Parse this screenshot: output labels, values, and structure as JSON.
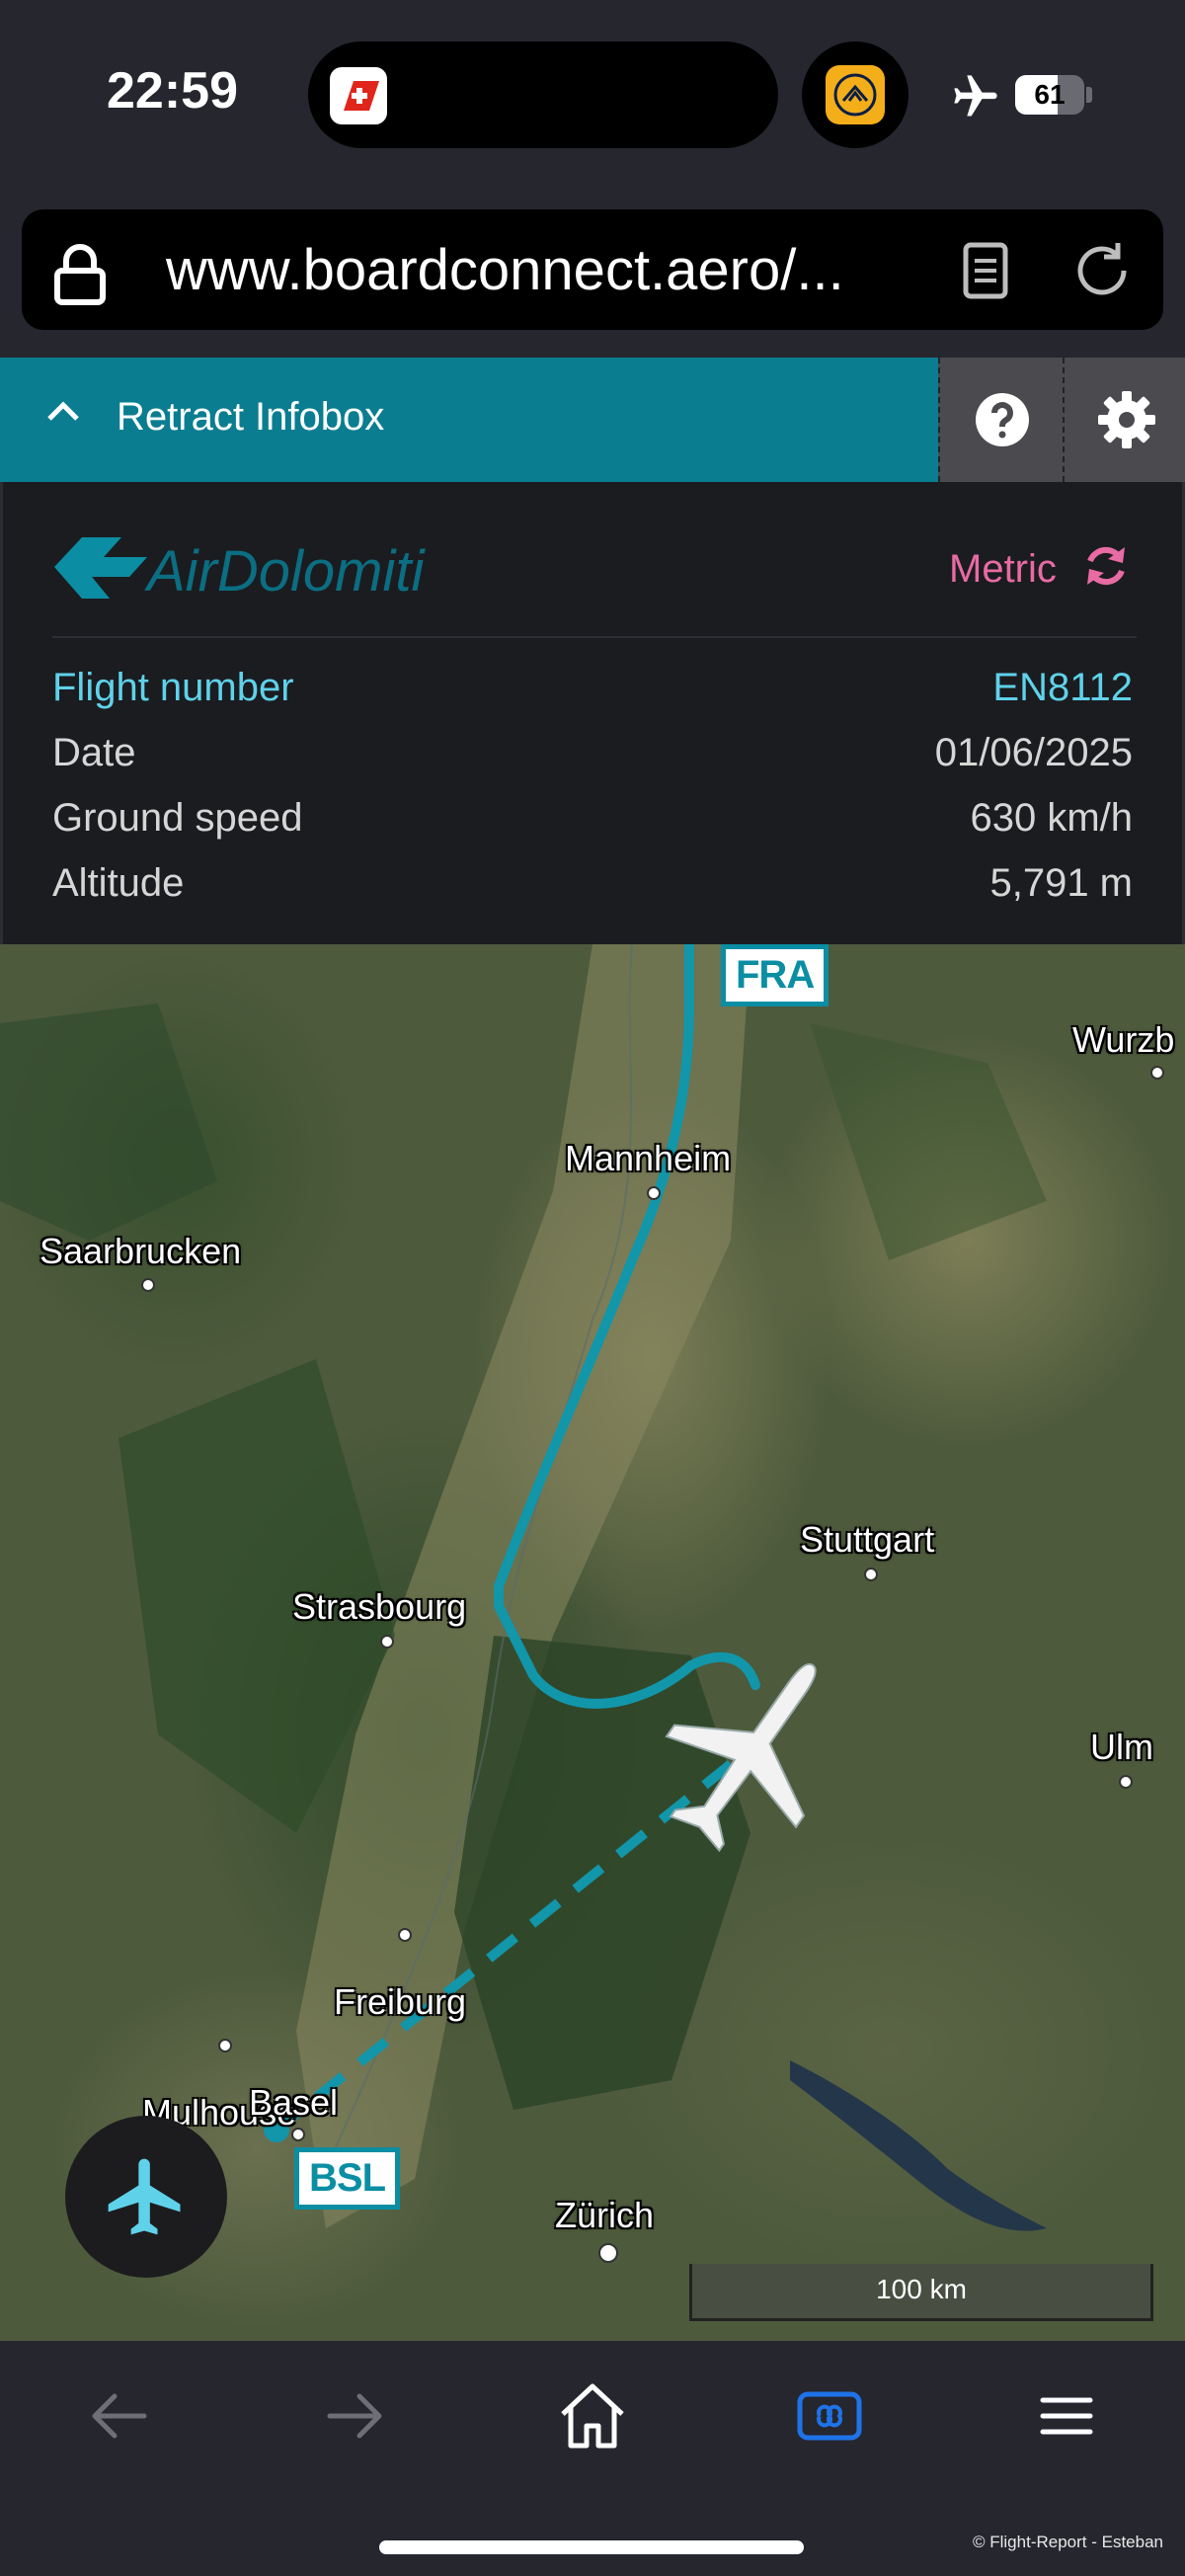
{
  "status_bar": {
    "time": "22:59",
    "left_app_icon": "swiss-app-icon",
    "right_app_icon": "lufthansa-app-icon",
    "airplane_mode_icon": "airplane-mode-icon",
    "battery": "61",
    "battery_level_percent": 61
  },
  "browser": {
    "url": "www.boardconnect.aero/...",
    "icons": [
      "lock-icon",
      "reader-icon",
      "reload-icon"
    ]
  },
  "infobox": {
    "retract_label": "Retract Infobox",
    "airline_logo_text": "AirDolomiti",
    "unit_toggle": "Metric",
    "rows": [
      {
        "label": "Flight number",
        "value": "EN8112"
      },
      {
        "label": "Date",
        "value": "01/06/2025"
      },
      {
        "label": "Ground speed",
        "value": "630 km/h"
      },
      {
        "label": "Altitude",
        "value": "5,791 m"
      }
    ]
  },
  "map": {
    "airports": {
      "origin": "BSL",
      "destination": "FRA"
    },
    "cities": [
      "Wurzb",
      "Mannheim",
      "Saarbrucken",
      "Stuttgart",
      "Strasbourg",
      "Ulm",
      "Freiburg",
      "Mulhouse",
      "Basel",
      "Zürich"
    ],
    "scale": "100 km",
    "route_color": "#1296aa"
  },
  "toolbar": {
    "icons": [
      "back-arrow-icon",
      "forward-arrow-icon",
      "home-icon",
      "tabs-icon",
      "menu-icon"
    ]
  },
  "footer": {
    "copyright": "© Flight-Report - Esteban"
  }
}
